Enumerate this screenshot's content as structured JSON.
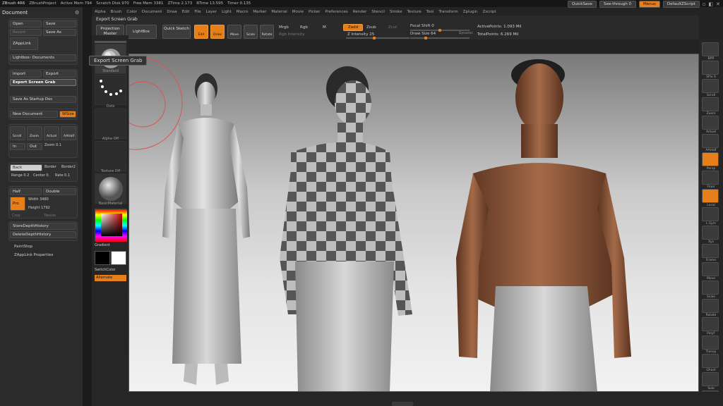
{
  "titlebar": {
    "app": "ZBrush 4R6",
    "project": "ZBrushProject",
    "active_mem": "Active Mem 794",
    "scratch_disk": "Scratch Disk 970",
    "free_mem": "Free Mem 3381",
    "ztime": "ZTime 2.173",
    "rtime": "RTime 13.595",
    "timer": "Timer 0.135"
  },
  "topright": {
    "quicksave": "QuickSave",
    "seethrough": "See-through",
    "seethrough_val": "0",
    "menus": "Menus",
    "script": "DefaultZScript"
  },
  "menubar": [
    "Alpha",
    "Brush",
    "Color",
    "Document",
    "Draw",
    "Edit",
    "File",
    "Layer",
    "Light",
    "Macro",
    "Marker",
    "Material",
    "Movie",
    "Picker",
    "Preferences",
    "Render",
    "Stencil",
    "Stroke",
    "Texture",
    "Tool",
    "Transform",
    "Zplugin",
    "Zscript"
  ],
  "left": {
    "title": "Document",
    "open": "Open",
    "save": "Save",
    "revert": "Revert",
    "save_as": "Save As",
    "zapplink": "ZAppLink",
    "lightbox_docs": "Lightbox› Documents",
    "import": "Import",
    "export": "Export",
    "export_screen_grab": "Export Screen Grab",
    "save_startup": "Save As Startup Doc",
    "new_document": "New Document",
    "wsize": "WSize",
    "scroll": "Scroll",
    "zoom": "Zoom",
    "actual": "Actual",
    "aahalf": "AAHalf",
    "in": "In",
    "out": "Out",
    "zoom_val": "Zoom 0.1",
    "back": "Back",
    "border": "Border",
    "border2": "Border2",
    "range": "Range 0.2",
    "center": "Center 0.",
    "rate": "Rate 0.1",
    "half": "Half",
    "double": "Double",
    "pro": "Pro",
    "width": "Width 3480",
    "height": "Height 1792",
    "crop": "Crop",
    "resize": "Resize",
    "store_depth": "StoreDepthHistory",
    "delete_depth": "DeleteDepthHistory",
    "paintstop": "PaintStop",
    "zapplink_props": "ZAppLink Properties"
  },
  "tooltip": "Export Screen Grab",
  "toptool": {
    "title": "Export Screen Grab",
    "projection_master": "Projection Master",
    "lightbox": "LightBox",
    "quick_sketch": "Quick Sketch",
    "edit": "Edit",
    "draw": "Draw",
    "move": "Move",
    "scale": "Scale",
    "rotate": "Rotate",
    "mrgb": "Mrgb",
    "rgb": "Rgb",
    "m": "M",
    "zadd": "Zadd",
    "zsub": "Zsub",
    "zcut": "Zcut",
    "rgb_intensity": "Rgb Intensity",
    "z_intensity": "Z Intensity 25",
    "focal_shift": "Focal Shift 0",
    "draw_size": "Draw Size 64",
    "dynamic": "Dynamic",
    "active_points": "ActivePoints: 1.093 Mil",
    "total_points": "TotalPoints: 6.269 Mil"
  },
  "toolcol": {
    "standard": "Standard",
    "dots": "Dots",
    "alpha_off": "Alpha Off",
    "texture_off": "Texture Off",
    "basic_material": "BasicMaterial",
    "gradient": "Gradient",
    "switch_color": "SwitchColor",
    "alternate": "Alternate"
  },
  "rightshelf": [
    "BPR",
    "SPix 0",
    "Scroll",
    "Zoom",
    "Actual",
    "AAHalf",
    "Persp",
    "Floor",
    "Local",
    "L.Sym",
    "Xyz",
    "Frame",
    "Move",
    "Scale",
    "Rotate",
    "PolyF",
    "Transp",
    "Ghost",
    "Solo",
    "Xpose"
  ]
}
